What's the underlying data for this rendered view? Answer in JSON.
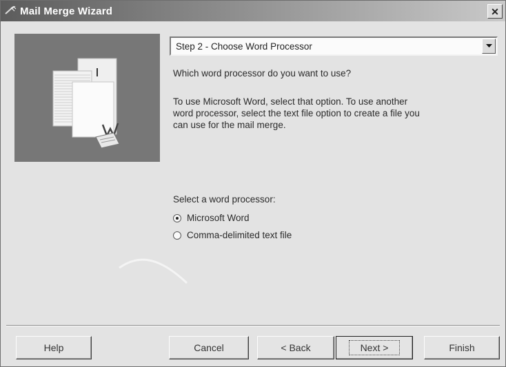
{
  "window": {
    "title": "Mail Merge Wizard",
    "close_glyph": "✕"
  },
  "step_dropdown": {
    "value": "Step 2 - Choose Word Processor"
  },
  "question": "Which word processor do you want to use?",
  "instructions": [
    "To use Microsoft Word, select that option. To use another",
    "word processor, select the text file option to create a file you",
    "can use for the mail merge."
  ],
  "selection": {
    "label": "Select a word processor:",
    "options": [
      {
        "label": "Microsoft Word",
        "checked": true
      },
      {
        "label": "Comma-delimited text file",
        "checked": false
      }
    ]
  },
  "buttons": {
    "help": "Help",
    "cancel": "Cancel",
    "back": "< Back",
    "next": "Next >",
    "finish": "Finish"
  },
  "icons": {
    "app": "wizard-wand-icon",
    "illustration": "documents-merge-icon",
    "dropdown": "chevron-down-icon"
  }
}
